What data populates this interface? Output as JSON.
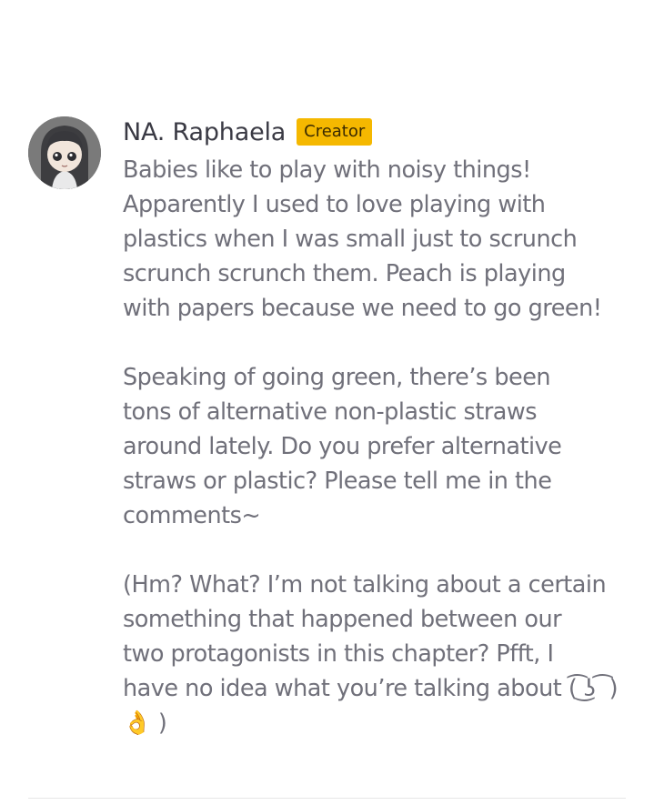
{
  "comment": {
    "author": "NA. Raphaela",
    "badge": "Creator",
    "avatar_icon": "chibi-character-avatar",
    "badge_color": "#f5b800",
    "paragraphs": [
      {
        "lines": [
          "Babies like to play with noisy things!",
          "Apparently I used to love playing with",
          "plastics when I was small just to scrunch",
          "scrunch scrunch them. Peach is playing",
          "with papers because we need to go green!"
        ]
      },
      {
        "lines": [
          "Speaking of going green, there’s been",
          "tons of alternative non-plastic straws",
          "around lately. Do you prefer alternative",
          "straws or plastic? Please tell me in the",
          "comments~"
        ]
      },
      {
        "lines": [
          "(Hm? What? I’m not talking about a certain",
          "something that happened between our",
          "two protagonists in this chapter? Pfft, I",
          "have no idea what you’re talking about (͡ ͜ʖ ͡ )",
          "👌 )"
        ]
      }
    ]
  }
}
